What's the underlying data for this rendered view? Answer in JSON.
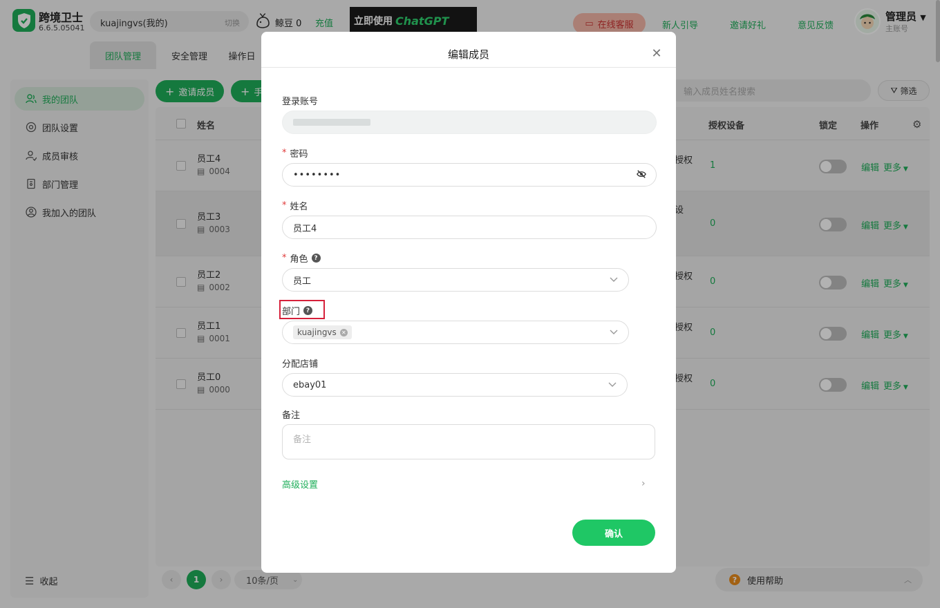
{
  "header": {
    "app_name": "跨境卫士",
    "version": "6.6.5.05041",
    "account": "kuajingvs(我的)",
    "switch": "切换",
    "beans": "鲸豆 0",
    "recharge": "充值",
    "banner_text": "立即使用",
    "banner_brand": "ChatGPT",
    "service": "在线客服",
    "links": [
      "新人引导",
      "邀请好礼",
      "意见反馈"
    ],
    "admin": "管理员",
    "admin_sub": "主账号",
    "tabs": [
      "团队管理",
      "安全管理",
      "操作日"
    ]
  },
  "sidebar": {
    "items": [
      "我的团队",
      "团队设置",
      "成员审核",
      "部门管理",
      "我加入的团队"
    ],
    "collapse": "收起"
  },
  "toolbar": {
    "invite": "邀请成员",
    "add": "手",
    "search_placeholder": "输入成员姓名搜索",
    "filter": "筛选"
  },
  "table": {
    "headers": {
      "name": "姓名",
      "devices": "授权设备",
      "lock": "锁定",
      "ops": "操作"
    },
    "rows": [
      {
        "name": "员工4",
        "id": "0004",
        "auth": "授权",
        "devices": "1"
      },
      {
        "name": "员工3",
        "id": "0003",
        "auth": "设",
        "devices": "0"
      },
      {
        "name": "员工2",
        "id": "0002",
        "auth": "授权",
        "devices": "0"
      },
      {
        "name": "员工1",
        "id": "0001",
        "auth": "授权",
        "devices": "0"
      },
      {
        "name": "员工0",
        "id": "0000",
        "auth": "授权",
        "devices": "0"
      }
    ],
    "edit": "编辑",
    "more": "更多"
  },
  "pager": {
    "current": "1",
    "size": "10条/页"
  },
  "help": "使用帮助",
  "modal": {
    "title": "编辑成员",
    "login_label": "登录账号",
    "password_label": "密码",
    "password_value": "••••••••",
    "name_label": "姓名",
    "name_value": "员工4",
    "role_label": "角色",
    "role_value": "员工",
    "dept_label": "部门",
    "dept_tag": "kuajingvs",
    "store_label": "分配店铺",
    "store_value": "ebay01",
    "note_label": "备注",
    "note_placeholder": "备注",
    "advanced": "高级设置",
    "confirm": "确认",
    "required_mark": "*"
  }
}
